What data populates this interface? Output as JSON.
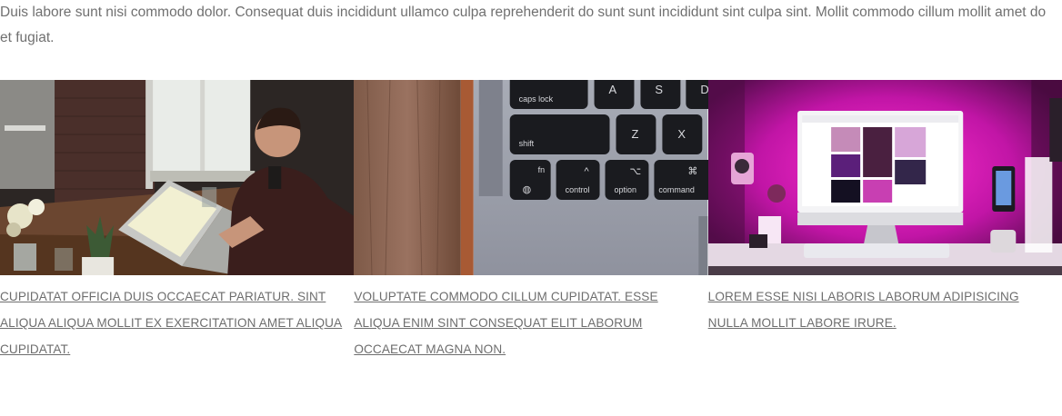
{
  "intro_text": "Duis labore sunt nisi commodo dolor. Consequat duis incididunt ullamco culpa reprehenderit do sunt sunt incididunt sint culpa sint. Mollit commodo cillum mollit amet do et fugiat.",
  "cards": [
    {
      "image": "person-typing-on-laptop-at-desk-photo",
      "caption": "CUPIDATAT OFFICIA DUIS OCCAECAT PARIATUR. SINT ALIQUA ALIQUA MOLLIT EX EXERCITATION AMET ALIQUA CUPIDATAT."
    },
    {
      "image": "laptop-keyboard-closeup-photo",
      "caption": "VOLUPTATE COMMODO CILLUM CUPIDATAT. ESSE ALIQUA ENIM SINT CONSEQUAT ELIT LABORUM OCCAECAT MAGNA NON.",
      "key_labels": {
        "caps_lock": "caps lock",
        "shift": "shift",
        "a": "A",
        "s": "S",
        "d": "D",
        "z": "Z",
        "x": "X",
        "fn": "fn",
        "control": "control",
        "option": "option",
        "command": "command",
        "control_symbol": "^",
        "option_symbol": "⌥",
        "command_symbol": "⌘"
      }
    },
    {
      "image": "desktop-monitor-pink-lighting-photo",
      "caption": "LOREM ESSE NISI LABORIS LABORUM ADIPISICING NULLA MOLLIT LABORE IRURE."
    }
  ]
}
